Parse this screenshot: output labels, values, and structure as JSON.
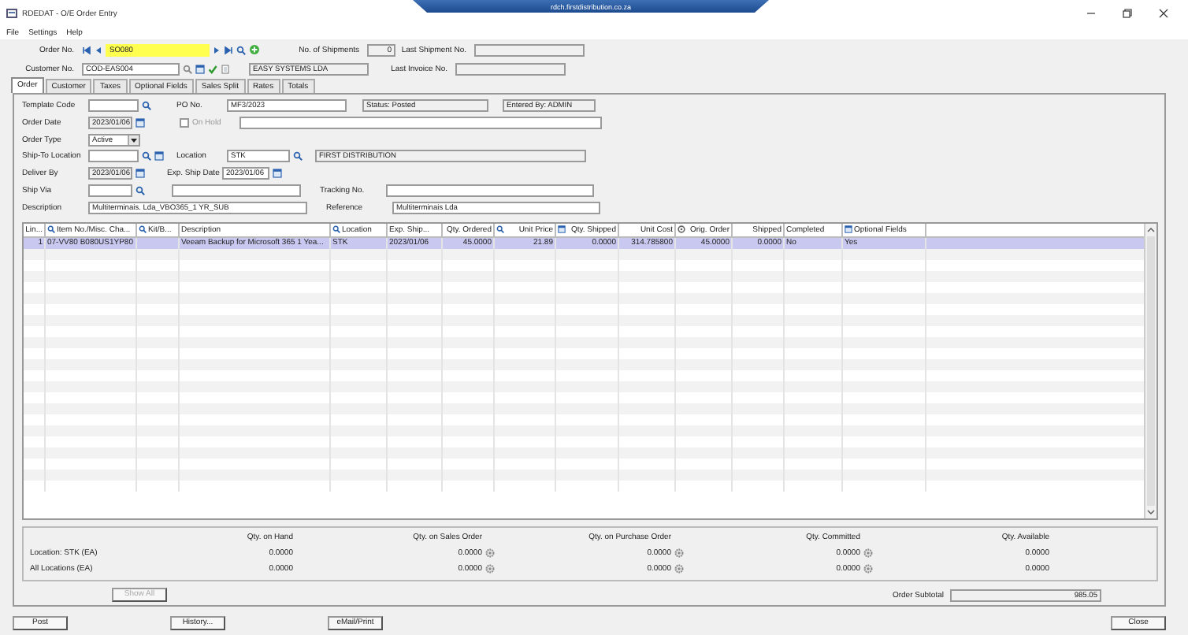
{
  "window": {
    "title": "RDEDAT - O/E Order Entry",
    "remote_host": "rdch.firstdistribution.co.za"
  },
  "menu": [
    "File",
    "Settings",
    "Help"
  ],
  "header": {
    "order_no": {
      "label": "Order No.",
      "value": "SO080"
    },
    "shipments": {
      "label": "No. of Shipments",
      "value": "0"
    },
    "last_shipment": {
      "label": "Last Shipment No."
    },
    "customer_no": {
      "label": "Customer No.",
      "value": "COD-EAS004"
    },
    "customer_name": {
      "value": "EASY SYSTEMS LDA"
    },
    "last_invoice": {
      "label": "Last Invoice No."
    }
  },
  "tabs": [
    {
      "label": "Order",
      "selected": true
    },
    {
      "label": "Customer",
      "selected": false
    },
    {
      "label": "Taxes",
      "selected": false
    },
    {
      "label": "Optional Fields",
      "selected": false
    },
    {
      "label": "Sales Split",
      "selected": false
    },
    {
      "label": "Rates",
      "selected": false
    },
    {
      "label": "Totals",
      "selected": false
    }
  ],
  "form": {
    "template_code": {
      "label": "Template Code"
    },
    "po_no": {
      "label": "PO No.",
      "value": "MF3/2023"
    },
    "status": "Status: Posted",
    "entered_by": "Entered By: ADMIN",
    "order_date": {
      "label": "Order Date",
      "value": "2023/01/06"
    },
    "on_hold": {
      "label": "On Hold",
      "checked": false,
      "disabled": true
    },
    "order_type": {
      "label": "Order Type",
      "value": "Active"
    },
    "ship_to_location": {
      "label": "Ship-To Location"
    },
    "location": {
      "label": "Location",
      "value": "STK"
    },
    "location_name": "FIRST DISTRIBUTION",
    "deliver_by": {
      "label": "Deliver By",
      "value": "2023/01/06"
    },
    "exp_ship_date": {
      "label": "Exp. Ship Date",
      "value": "2023/01/06"
    },
    "ship_via": {
      "label": "Ship Via"
    },
    "tracking_no": {
      "label": "Tracking No."
    },
    "description": {
      "label": "Description",
      "value": "Multiterminais. Lda_VBO365_1 YR_SUB"
    },
    "reference": {
      "label": "Reference",
      "value": "Multiterminais Lda"
    }
  },
  "table": {
    "columns": [
      "Lin...",
      "Item No./Misc. Cha...",
      "Kit/B...",
      "Description",
      "Location",
      "Exp. Ship...",
      "Qty. Ordered",
      "Unit Price",
      "Qty. Shipped",
      "Unit Cost",
      "Orig. Order",
      "Shipped",
      "Completed",
      "Optional Fields"
    ],
    "rows": [
      {
        "selected": true,
        "cells": [
          "1",
          "07-VV80 B080US1YP80",
          "",
          "Veeam Backup for Microsoft 365 1 Yea...",
          "STK",
          "2023/01/06",
          "45.0000",
          "21.89",
          "0.0000",
          "314.785800",
          "45.0000",
          "0.0000",
          "No",
          "Yes"
        ]
      }
    ]
  },
  "quantities": {
    "columns": [
      "Qty. on Hand",
      "Qty. on Sales Order",
      "Qty. on Purchase Order",
      "Qty. Committed",
      "Qty. Available"
    ],
    "rows": [
      {
        "label": "Location: STK (EA)",
        "values": [
          "0.0000",
          "0.0000",
          "0.0000",
          "0.0000",
          "0.0000"
        ]
      },
      {
        "label": "All Locations (EA)",
        "values": [
          "0.0000",
          "0.0000",
          "0.0000",
          "0.0000",
          "0.0000"
        ]
      }
    ],
    "show_all": {
      "label": "Show All",
      "disabled": true
    }
  },
  "subtotal": {
    "label": "Order Subtotal",
    "value": "985.05"
  },
  "buttons": [
    "Post",
    "History...",
    "eMail/Print"
  ],
  "close_button": "Close"
}
